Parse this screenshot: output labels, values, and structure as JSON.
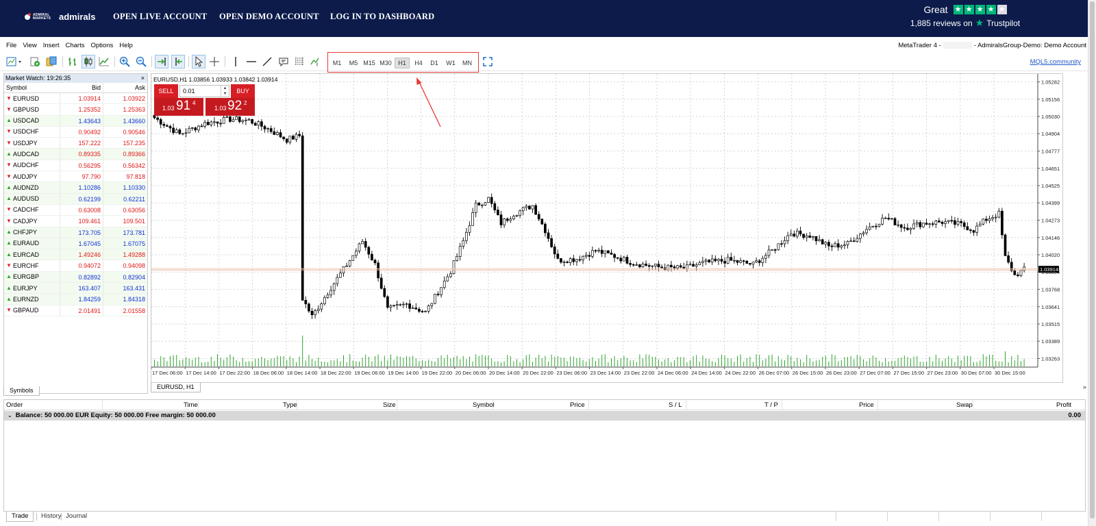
{
  "brand": {
    "logo_sub": "ADMIRAL MARKETS",
    "logo_name": "admirals"
  },
  "top_nav": [
    "OPEN LIVE ACCOUNT",
    "OPEN DEMO ACCOUNT",
    "LOG IN TO DASHBOARD"
  ],
  "trustpilot": {
    "rating_text": "Great",
    "reviews": "1,885 reviews on",
    "brand": "Trustpilot",
    "stars_filled": 4,
    "stars_total": 5
  },
  "menu": [
    "File",
    "View",
    "Insert",
    "Charts",
    "Options",
    "Help"
  ],
  "window_title": {
    "left": "MetaTrader 4 -",
    "right": "- AdmiralsGroup-Demo: Demo Account"
  },
  "timeframes": [
    "M1",
    "M5",
    "M15",
    "M30",
    "H1",
    "H4",
    "D1",
    "W1",
    "MN"
  ],
  "active_timeframe": "H1",
  "mql5_link": "MQL5.community",
  "market_watch": {
    "title": "Market Watch: 19:26:35",
    "close": "×",
    "columns": [
      "Symbol",
      "Bid",
      "Ask"
    ],
    "rows": [
      {
        "symbol": "EURUSD",
        "bid": "1.03914",
        "ask": "1.03922",
        "dir": "down",
        "color": "red"
      },
      {
        "symbol": "GBPUSD",
        "bid": "1.25352",
        "ask": "1.25363",
        "dir": "down",
        "color": "red"
      },
      {
        "symbol": "USDCAD",
        "bid": "1.43643",
        "ask": "1.43660",
        "dir": "up",
        "color": "blue"
      },
      {
        "symbol": "USDCHF",
        "bid": "0.90492",
        "ask": "0.90546",
        "dir": "down",
        "color": "red"
      },
      {
        "symbol": "USDJPY",
        "bid": "157.222",
        "ask": "157.235",
        "dir": "down",
        "color": "red"
      },
      {
        "symbol": "AUDCAD",
        "bid": "0.89335",
        "ask": "0.89366",
        "dir": "up",
        "color": "red"
      },
      {
        "symbol": "AUDCHF",
        "bid": "0.56295",
        "ask": "0.56342",
        "dir": "down",
        "color": "red"
      },
      {
        "symbol": "AUDJPY",
        "bid": "97.790",
        "ask": "97.818",
        "dir": "down",
        "color": "red"
      },
      {
        "symbol": "AUDNZD",
        "bid": "1.10286",
        "ask": "1.10330",
        "dir": "up",
        "color": "blue"
      },
      {
        "symbol": "AUDUSD",
        "bid": "0.62199",
        "ask": "0.62211",
        "dir": "up",
        "color": "blue"
      },
      {
        "symbol": "CADCHF",
        "bid": "0.63008",
        "ask": "0.63056",
        "dir": "down",
        "color": "red"
      },
      {
        "symbol": "CADJPY",
        "bid": "109.461",
        "ask": "109.501",
        "dir": "down",
        "color": "red"
      },
      {
        "symbol": "CHFJPY",
        "bid": "173.705",
        "ask": "173.781",
        "dir": "up",
        "color": "blue"
      },
      {
        "symbol": "EURAUD",
        "bid": "1.67045",
        "ask": "1.67075",
        "dir": "up",
        "color": "blue"
      },
      {
        "symbol": "EURCAD",
        "bid": "1.49246",
        "ask": "1.49288",
        "dir": "up",
        "color": "red"
      },
      {
        "symbol": "EURCHF",
        "bid": "0.94072",
        "ask": "0.94098",
        "dir": "down",
        "color": "red"
      },
      {
        "symbol": "EURGBP",
        "bid": "0.82892",
        "ask": "0.82904",
        "dir": "up",
        "color": "blue"
      },
      {
        "symbol": "EURJPY",
        "bid": "163.407",
        "ask": "163.431",
        "dir": "up",
        "color": "blue"
      },
      {
        "symbol": "EURNZD",
        "bid": "1.84259",
        "ask": "1.84318",
        "dir": "up",
        "color": "blue"
      },
      {
        "symbol": "GBPAUD",
        "bid": "2.01491",
        "ask": "2.01558",
        "dir": "down",
        "color": "red"
      }
    ],
    "tab": "Symbols"
  },
  "chart": {
    "info": "EURUSD,H1  1.03856 1.03933 1.03842 1.03914",
    "tab": "EURUSD, H1",
    "scroll_arrow": "»",
    "one_click": {
      "sell": "SELL",
      "buy": "BUY",
      "lot": "0.01",
      "sell_prefix": "1.03",
      "sell_big": "91",
      "sell_sup": "4",
      "buy_prefix": "1.03",
      "buy_big": "92",
      "buy_sup": "2"
    }
  },
  "chart_data": {
    "type": "candlestick",
    "symbol": "EURUSD",
    "timeframe": "H1",
    "current_price": "1.03914",
    "y_ticks": [
      "1.05282",
      "1.05156",
      "1.05030",
      "1.04904",
      "1.04777",
      "1.04651",
      "1.04525",
      "1.04399",
      "1.04273",
      "1.04146",
      "1.04020",
      "1.03894",
      "1.03768",
      "1.03641",
      "1.03515",
      "1.03389",
      "1.03263"
    ],
    "ylim": [
      1.032,
      1.0534
    ],
    "x_ticks": [
      "17 Dec 06:00",
      "17 Dec 14:00",
      "17 Dec 22:00",
      "18 Dec 06:00",
      "18 Dec 14:00",
      "18 Dec 22:00",
      "19 Dec 06:00",
      "19 Dec 14:00",
      "19 Dec 22:00",
      "20 Dec 06:00",
      "20 Dec 14:00",
      "20 Dec 22:00",
      "23 Dec 06:00",
      "23 Dec 14:00",
      "23 Dec 22:00",
      "24 Dec 06:00",
      "24 Dec 14:00",
      "24 Dec 22:00",
      "26 Dec 07:00",
      "26 Dec 15:00",
      "26 Dec 23:00",
      "27 Dec 07:00",
      "27 Dec 15:00",
      "27 Dec 23:00",
      "30 Dec 07:00",
      "30 Dec 15:00"
    ],
    "close_anchors": [
      [
        0,
        1.0502
      ],
      [
        8,
        1.049
      ],
      [
        16,
        1.0498
      ],
      [
        24,
        1.0501
      ],
      [
        30,
        1.05
      ],
      [
        36,
        1.0494
      ],
      [
        42,
        1.0486
      ],
      [
        46,
        1.0489
      ],
      [
        47,
        1.037
      ],
      [
        50,
        1.0357
      ],
      [
        56,
        1.0378
      ],
      [
        62,
        1.0398
      ],
      [
        66,
        1.0412
      ],
      [
        70,
        1.0395
      ],
      [
        74,
        1.0362
      ],
      [
        80,
        1.0366
      ],
      [
        86,
        1.036
      ],
      [
        90,
        1.0375
      ],
      [
        94,
        1.039
      ],
      [
        98,
        1.0412
      ],
      [
        102,
        1.0438
      ],
      [
        106,
        1.0443
      ],
      [
        110,
        1.0425
      ],
      [
        114,
        1.0432
      ],
      [
        120,
        1.0438
      ],
      [
        124,
        1.042
      ],
      [
        128,
        1.0398
      ],
      [
        134,
        1.0399
      ],
      [
        140,
        1.0405
      ],
      [
        146,
        1.0401
      ],
      [
        152,
        1.0396
      ],
      [
        160,
        1.0393
      ],
      [
        168,
        1.0392
      ],
      [
        174,
        1.0396
      ],
      [
        182,
        1.0398
      ],
      [
        190,
        1.0395
      ],
      [
        196,
        1.0405
      ],
      [
        202,
        1.0418
      ],
      [
        208,
        1.0416
      ],
      [
        214,
        1.0408
      ],
      [
        220,
        1.041
      ],
      [
        226,
        1.0421
      ],
      [
        232,
        1.0429
      ],
      [
        238,
        1.0422
      ],
      [
        244,
        1.0425
      ],
      [
        250,
        1.0426
      ],
      [
        256,
        1.0424
      ],
      [
        260,
        1.042
      ],
      [
        264,
        1.0428
      ],
      [
        268,
        1.0432
      ],
      [
        270,
        1.04
      ],
      [
        273,
        1.0387
      ],
      [
        276,
        1.0391
      ]
    ]
  },
  "terminal": {
    "columns": [
      "Order",
      "Time",
      "Type",
      "Size",
      "Symbol",
      "Price",
      "S / L",
      "T / P",
      "Price",
      "Swap",
      "Profit"
    ],
    "balance_line": "Balance: 50 000.00 EUR  Equity: 50 000.00  Free margin: 50 000.00",
    "profit": "0.00",
    "tabs": [
      "Trade",
      "History",
      "Journal"
    ]
  },
  "colors": {
    "topbar": "#0c1b4a",
    "accent_red": "#d71e24",
    "link_blue": "#1f57c8",
    "trustpilot_green": "#00b67a"
  }
}
